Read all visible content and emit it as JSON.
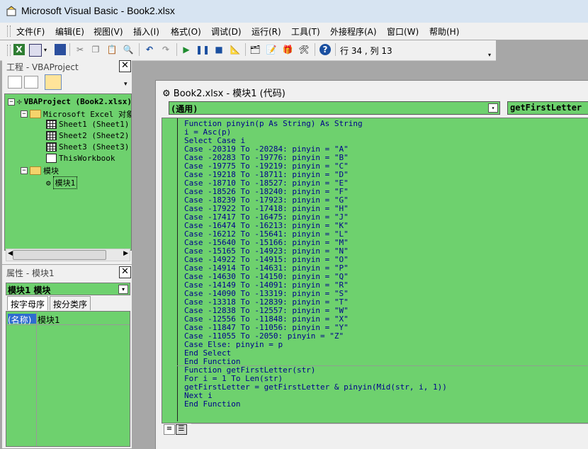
{
  "window": {
    "title": "Microsoft Visual Basic - Book2.xlsx"
  },
  "menu": [
    "文件(F)",
    "编辑(E)",
    "视图(V)",
    "插入(I)",
    "格式(O)",
    "调试(D)",
    "运行(R)",
    "工具(T)",
    "外接程序(A)",
    "窗口(W)",
    "帮助(H)"
  ],
  "toolbar": {
    "icons": [
      "excel-icon",
      "insert-userform-icon",
      "dropdown-icon",
      "save-icon",
      "cut-icon",
      "copy-icon",
      "paste-icon",
      "find-icon",
      "undo-icon",
      "redo-icon",
      "run-icon",
      "break-icon",
      "reset-icon",
      "design-mode-icon",
      "project-explorer-icon",
      "properties-icon",
      "object-browser-icon",
      "toolbox-icon",
      "help-icon"
    ],
    "position": "行 34 , 列 13"
  },
  "project_pane": {
    "title": "工程 - VBAProject",
    "tree": [
      {
        "label": "VBAProject (Book2.xlsx)",
        "level": 0
      },
      {
        "label": "Microsoft Excel 对象",
        "level": 1
      },
      {
        "label": "Sheet1 (Sheet1)",
        "level": 2
      },
      {
        "label": "Sheet2 (Sheet2)",
        "level": 2
      },
      {
        "label": "Sheet3 (Sheet3)",
        "level": 2
      },
      {
        "label": "ThisWorkbook",
        "level": 2
      },
      {
        "label": "模块",
        "level": 1
      },
      {
        "label": "模块1",
        "level": 2
      }
    ]
  },
  "properties_pane": {
    "title": "属性 - 模块1",
    "object": "模块1 模块",
    "tabs": [
      "按字母序",
      "按分类序"
    ],
    "rows": [
      {
        "name": "(名称)",
        "value": "模块1"
      }
    ]
  },
  "code_window": {
    "title": "Book2.xlsx - 模块1 (代码)",
    "object_combo": "(通用)",
    "proc_combo": "getFirstLetter",
    "lines": [
      "Function pinyin(p As String) As String",
      "i = Asc(p)",
      "Select Case i",
      "Case -20319 To -20284: pinyin = \"A\"",
      "Case -20283 To -19776: pinyin = \"B\"",
      "Case -19775 To -19219: pinyin = \"C\"",
      "Case -19218 To -18711: pinyin = \"D\"",
      "Case -18710 To -18527: pinyin = \"E\"",
      "Case -18526 To -18240: pinyin = \"F\"",
      "Case -18239 To -17923: pinyin = \"G\"",
      "Case -17922 To -17418: pinyin = \"H\"",
      "Case -17417 To -16475: pinyin = \"J\"",
      "Case -16474 To -16213: pinyin = \"K\"",
      "Case -16212 To -15641: pinyin = \"L\"",
      "Case -15640 To -15166: pinyin = \"M\"",
      "Case -15165 To -14923: pinyin = \"N\"",
      "Case -14922 To -14915: pinyin = \"O\"",
      "Case -14914 To -14631: pinyin = \"P\"",
      "Case -14630 To -14150: pinyin = \"Q\"",
      "Case -14149 To -14091: pinyin = \"R\"",
      "Case -14090 To -13319: pinyin = \"S\"",
      "Case -13318 To -12839: pinyin = \"T\"",
      "Case -12838 To -12557: pinyin = \"W\"",
      "Case -12556 To -11848: pinyin = \"X\"",
      "Case -11847 To -11056: pinyin = \"Y\"",
      "Case -11055 To -2050: pinyin = \"Z\"",
      "Case Else: pinyin = p",
      "End Select",
      "End Function",
      "Function getFirstLetter(str)",
      "For i = 1 To Len(str)",
      "getFirstLetter = getFirstLetter & pinyin(Mid(str, i, 1))",
      "Next i",
      "End Function"
    ]
  }
}
